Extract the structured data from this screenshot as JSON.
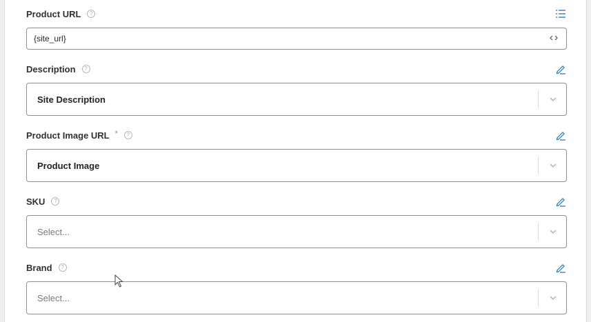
{
  "fields": {
    "product_url": {
      "label": "Product URL",
      "value": "{site_url}"
    },
    "description": {
      "label": "Description",
      "selected": "Site Description"
    },
    "product_image_url": {
      "label": "Product Image URL",
      "required_mark": "*",
      "selected": "Product Image"
    },
    "sku": {
      "label": "SKU",
      "placeholder": "Select..."
    },
    "brand": {
      "label": "Brand",
      "placeholder": "Select..."
    }
  },
  "help_glyph": "?",
  "colors": {
    "accent": "#2271b1",
    "border": "#8c8f94",
    "label": "#2c3338"
  }
}
